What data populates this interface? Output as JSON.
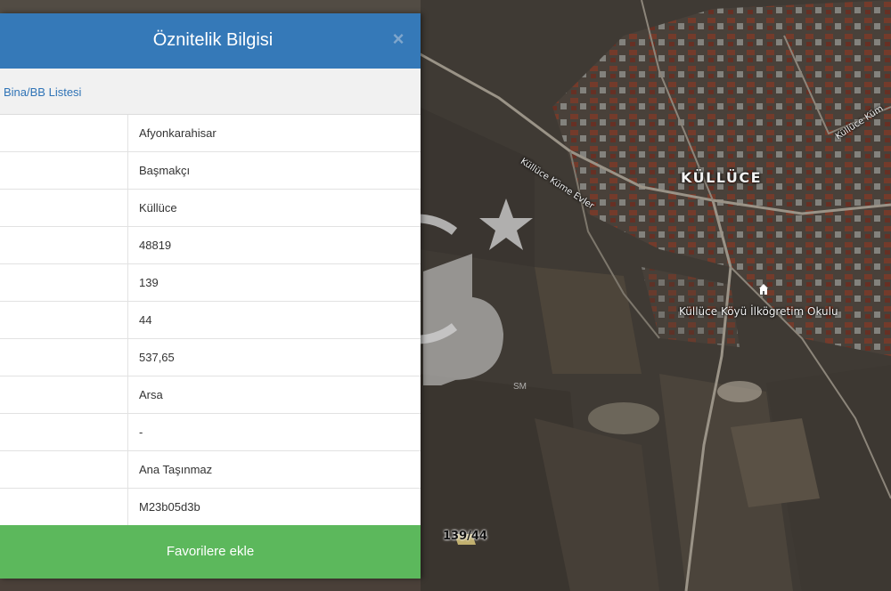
{
  "panel": {
    "title": "Öznitelik Bilgisi",
    "close_symbol": "×",
    "list_link": "Bina/BB Listesi",
    "rows": [
      {
        "key": "",
        "value": "Afyonkarahisar"
      },
      {
        "key": "",
        "value": "Başmakçı"
      },
      {
        "key": "",
        "value": "Küllüce"
      },
      {
        "key": "",
        "value": "48819"
      },
      {
        "key": "",
        "value": "139"
      },
      {
        "key": "",
        "value": "44"
      },
      {
        "key": "",
        "value": "537,65"
      },
      {
        "key": "",
        "value": "Arsa"
      },
      {
        "key": "",
        "value": "-"
      },
      {
        "key": "",
        "value": "Ana Taşınmaz"
      },
      {
        "key": "",
        "value": "M23b05d3b"
      }
    ],
    "favorite_button": "Favorilere ekle"
  },
  "map": {
    "town_label": "KÜLLÜCE",
    "school_label": "Küllüce Köyü İlkögretim Okulu",
    "road_label_1": "Küllüce Küme Evler",
    "road_label_2": "Küllüce Küm",
    "parcel_label": "139/44",
    "school_icon": "school-icon"
  },
  "watermark": {
    "mark": "SM",
    "icon": "coldwell-banker-logo"
  },
  "colors": {
    "header": "#3579b8",
    "favorite": "#5cb85c",
    "link": "#2f73b6"
  }
}
